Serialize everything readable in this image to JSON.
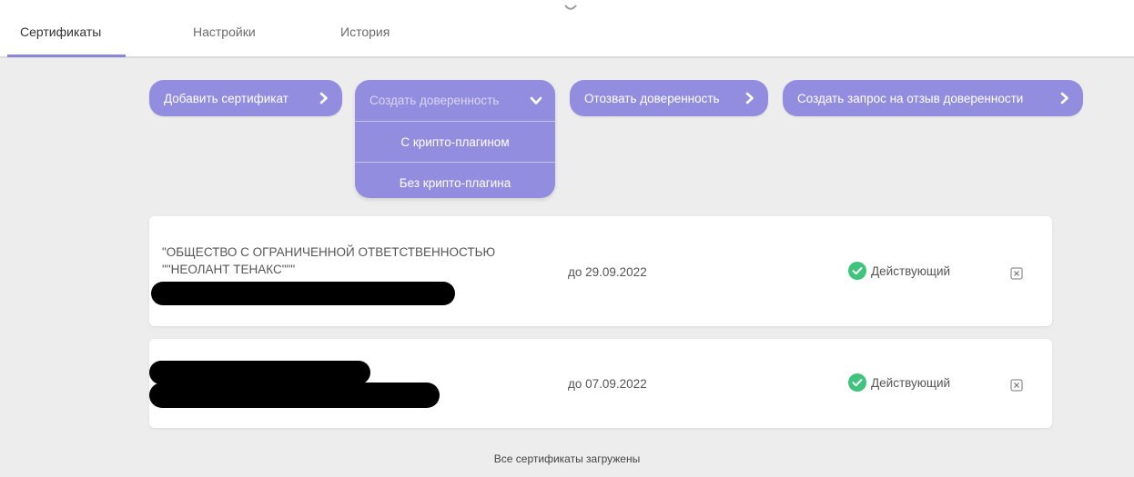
{
  "tabs": [
    {
      "label": "Сертификаты",
      "active": true
    },
    {
      "label": "Настройки",
      "active": false
    },
    {
      "label": "История",
      "active": false
    }
  ],
  "actions": {
    "add_certificate": "Добавить сертификат",
    "create_poa": "Создать доверенность",
    "revoke_poa": "Отозвать доверенность",
    "create_revoke_request": "Создать запрос на отзыв доверенности"
  },
  "create_poa_menu": {
    "items": [
      "С крипто-плагином",
      "Без крипто-плагина"
    ]
  },
  "certificates": [
    {
      "name_line1": "\"ОБЩЕСТВО С ОГРАНИЧЕННОЙ ОТВЕТСТВЕННОСТЬЮ",
      "name_line2": "\"\"НЕОЛАНТ ТЕНАКС\"\"\"",
      "valid_until": "до 29.09.2022",
      "status": "Действующий"
    },
    {
      "valid_until": "до 07.09.2022",
      "status": "Действующий"
    }
  ],
  "footer": "Все сертификаты загружены",
  "colors": {
    "accent": "#938ddf",
    "status_ok": "#3fc37d",
    "background": "#ededed"
  },
  "icons": {
    "chevron_right": "chevron-right-icon",
    "chevron_down": "chevron-down-icon",
    "status_check": "check-circle-icon",
    "close": "close-icon",
    "loading": "spinner-icon"
  }
}
